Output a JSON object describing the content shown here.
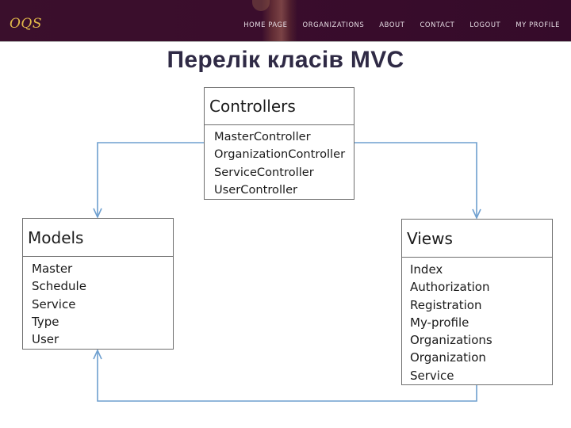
{
  "header": {
    "logo": "OQS",
    "nav": [
      {
        "label": "HOME PAGE"
      },
      {
        "label": "ORGANIZATIONS"
      },
      {
        "label": "ABOUT"
      },
      {
        "label": "CONTACT"
      },
      {
        "label": "LOGOUT"
      },
      {
        "label": "MY PROFILE"
      }
    ],
    "colors": {
      "background": "#3a0f2c",
      "logo": "#e2b94a",
      "nav_text": "#e6dde4"
    }
  },
  "slide": {
    "title": "Перелік класів MVC",
    "title_color": "#2f2a45",
    "connector_color": "#6e9fcf"
  },
  "diagram": {
    "controllers": {
      "name": "Controllers",
      "items": [
        "MasterController",
        "OrganizationController",
        "ServiceController",
        "UserController"
      ]
    },
    "models": {
      "name": "Models",
      "items": [
        "Master",
        "Schedule",
        "Service",
        "Type",
        "User"
      ]
    },
    "views": {
      "name": "Views",
      "items": [
        "Index",
        "Authorization",
        "Registration",
        "My-profile",
        "Organizations",
        "Organization",
        "Service"
      ]
    },
    "connections": [
      {
        "from": "controllers",
        "to": "models",
        "arrow": "open"
      },
      {
        "from": "controllers",
        "to": "views",
        "arrow": "open"
      },
      {
        "from": "views",
        "to": "models",
        "arrow": "open"
      }
    ]
  }
}
